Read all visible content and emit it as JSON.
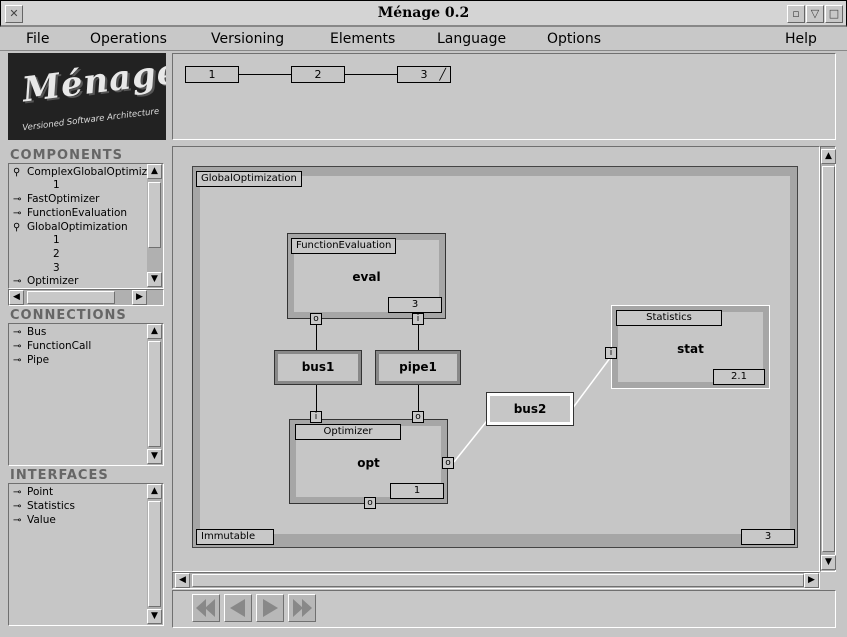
{
  "window": {
    "title": "Ménage 0.2"
  },
  "menu": [
    "File",
    "Operations",
    "Versioning",
    "Elements",
    "Language",
    "Options",
    "Help"
  ],
  "logo": {
    "title": "Ménage",
    "subtitle": "Versioned Software Architecture"
  },
  "components": {
    "title": "COMPONENTS",
    "items": [
      "ComplexGlobalOptimiz",
      "1",
      "FastOptimizer",
      "FunctionEvaluation",
      "GlobalOptimization",
      "1",
      "2",
      "3",
      "Optimizer"
    ]
  },
  "connections": {
    "title": "CONNECTIONS",
    "items": [
      "Bus",
      "FunctionCall",
      "Pipe"
    ]
  },
  "interfaces": {
    "title": "INTERFACES",
    "items": [
      "Point",
      "Statistics",
      "Value"
    ]
  },
  "versions": [
    "1",
    "2",
    "3"
  ],
  "diagram": {
    "frame_label": "GlobalOptimization",
    "status": "Immutable",
    "version": "3",
    "components": [
      {
        "type": "FunctionEvaluation",
        "name": "eval",
        "version": "3"
      },
      {
        "type": "Statistics",
        "name": "stat",
        "version": "2.1"
      },
      {
        "type": "Optimizer",
        "name": "opt",
        "version": "1"
      }
    ],
    "connectors": [
      "bus1",
      "pipe1",
      "bus2"
    ],
    "ports": {
      "out": "o",
      "in": "i"
    }
  },
  "icons": {
    "key": "key-icon",
    "arrow_up": "▲",
    "arrow_down": "▼",
    "arrow_left": "◀",
    "arrow_right": "▶"
  }
}
